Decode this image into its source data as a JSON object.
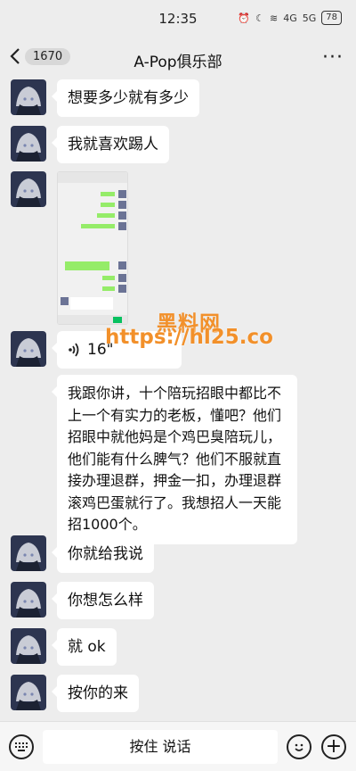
{
  "status_bar": {
    "time": "12:35",
    "battery": "78",
    "signal_1": "4G",
    "signal_2": "5G"
  },
  "nav": {
    "unread_count": "1670",
    "title": "A-Pop俱乐部",
    "more": "···"
  },
  "messages": [
    {
      "type": "text",
      "text": "想要多少就有多少"
    },
    {
      "type": "text",
      "text": "我就喜欢踢人"
    },
    {
      "type": "image",
      "description": ""
    },
    {
      "type": "voice",
      "duration": "16\""
    },
    {
      "type": "text",
      "text": "我跟你讲，十个陪玩招眼中都比不上一个有实力的老板，懂吧？他们招眼中就他妈是个鸡巴臭陪玩儿，他们能有什么脾气？他们不服就直接办理退群，押金一扣，办理退群滚鸡巴蛋就行了。我想招人一天能招1000个。"
    },
    {
      "type": "text",
      "text": "你就给我说"
    },
    {
      "type": "text",
      "text": "你想怎么样"
    },
    {
      "type": "text",
      "text": "就 ok"
    },
    {
      "type": "text",
      "text": "按你的来"
    }
  ],
  "watermark": {
    "cn": "黑料网",
    "url": "https://hl25.co"
  },
  "input_bar": {
    "hold_to_talk": "按住 说话",
    "plus": "+"
  },
  "colors": {
    "background": "#ededed",
    "bubble": "#ffffff",
    "watermark": "#f2902a",
    "unread_dot": "#fa5151"
  }
}
